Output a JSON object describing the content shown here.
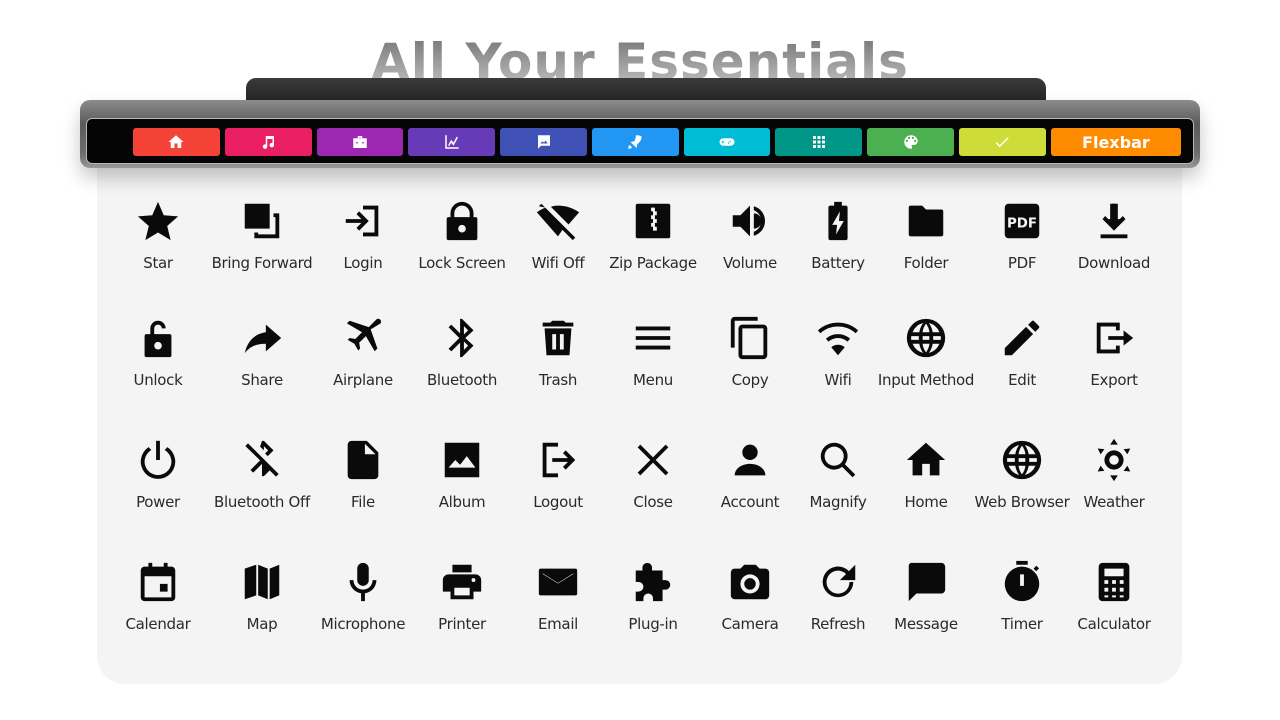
{
  "page": {
    "title": "All Your Essentials"
  },
  "device": {
    "tabs": [
      {
        "icon": "home-icon",
        "color": "#f44336",
        "label": ""
      },
      {
        "icon": "music-note-icon",
        "color": "#e91e63",
        "label": ""
      },
      {
        "icon": "toolbox-icon",
        "color": "#9c27b0",
        "label": ""
      },
      {
        "icon": "chart-line-icon",
        "color": "#673ab7",
        "label": ""
      },
      {
        "icon": "image-message-icon",
        "color": "#3f51b5",
        "label": ""
      },
      {
        "icon": "rocket-icon",
        "color": "#2196f3",
        "label": ""
      },
      {
        "icon": "gamepad-icon",
        "color": "#00bcd4",
        "label": ""
      },
      {
        "icon": "apps-grid-icon",
        "color": "#009688",
        "label": ""
      },
      {
        "icon": "palette-icon",
        "color": "#4caf50",
        "label": ""
      },
      {
        "icon": "check-icon",
        "color": "#cddc39",
        "label": ""
      },
      {
        "icon": "",
        "color": "#ff8c00",
        "label": "Flexbar"
      }
    ]
  },
  "icons": [
    {
      "name": "star-icon",
      "label": "Star"
    },
    {
      "name": "bring-forward-icon",
      "label": "Bring Forward"
    },
    {
      "name": "login-icon",
      "label": "Login"
    },
    {
      "name": "lock-icon",
      "label": "Lock Screen"
    },
    {
      "name": "wifi-off-icon",
      "label": "Wifi Off"
    },
    {
      "name": "zip-package-icon",
      "label": "Zip Package"
    },
    {
      "name": "volume-icon",
      "label": "Volume"
    },
    {
      "name": "battery-icon",
      "label": "Battery"
    },
    {
      "name": "folder-icon",
      "label": "Folder"
    },
    {
      "name": "pdf-icon",
      "label": "PDF"
    },
    {
      "name": "download-icon",
      "label": "Download"
    },
    {
      "name": "unlock-icon",
      "label": "Unlock"
    },
    {
      "name": "share-icon",
      "label": "Share"
    },
    {
      "name": "airplane-icon",
      "label": "Airplane"
    },
    {
      "name": "bluetooth-icon",
      "label": "Bluetooth"
    },
    {
      "name": "trash-icon",
      "label": "Trash"
    },
    {
      "name": "menu-icon",
      "label": "Menu"
    },
    {
      "name": "copy-icon",
      "label": "Copy"
    },
    {
      "name": "wifi-icon",
      "label": "Wifi"
    },
    {
      "name": "input-method-icon",
      "label": "Input Method"
    },
    {
      "name": "edit-icon",
      "label": "Edit"
    },
    {
      "name": "export-icon",
      "label": "Export"
    },
    {
      "name": "power-icon",
      "label": "Power"
    },
    {
      "name": "bluetooth-off-icon",
      "label": "Bluetooth Off"
    },
    {
      "name": "file-icon",
      "label": "File"
    },
    {
      "name": "album-icon",
      "label": "Album"
    },
    {
      "name": "logout-icon",
      "label": "Logout"
    },
    {
      "name": "close-icon",
      "label": "Close"
    },
    {
      "name": "account-icon",
      "label": "Account"
    },
    {
      "name": "magnify-icon",
      "label": "Magnify"
    },
    {
      "name": "home-icon",
      "label": "Home"
    },
    {
      "name": "web-browser-icon",
      "label": "Web Browser"
    },
    {
      "name": "weather-icon",
      "label": "Weather"
    },
    {
      "name": "calendar-icon",
      "label": "Calendar"
    },
    {
      "name": "map-icon",
      "label": "Map"
    },
    {
      "name": "microphone-icon",
      "label": "Microphone"
    },
    {
      "name": "printer-icon",
      "label": "Printer"
    },
    {
      "name": "email-icon",
      "label": "Email"
    },
    {
      "name": "plug-in-icon",
      "label": "Plug-in"
    },
    {
      "name": "camera-icon",
      "label": "Camera"
    },
    {
      "name": "refresh-icon",
      "label": "Refresh"
    },
    {
      "name": "message-icon",
      "label": "Message"
    },
    {
      "name": "timer-icon",
      "label": "Timer"
    },
    {
      "name": "calculator-icon",
      "label": "Calculator"
    }
  ]
}
